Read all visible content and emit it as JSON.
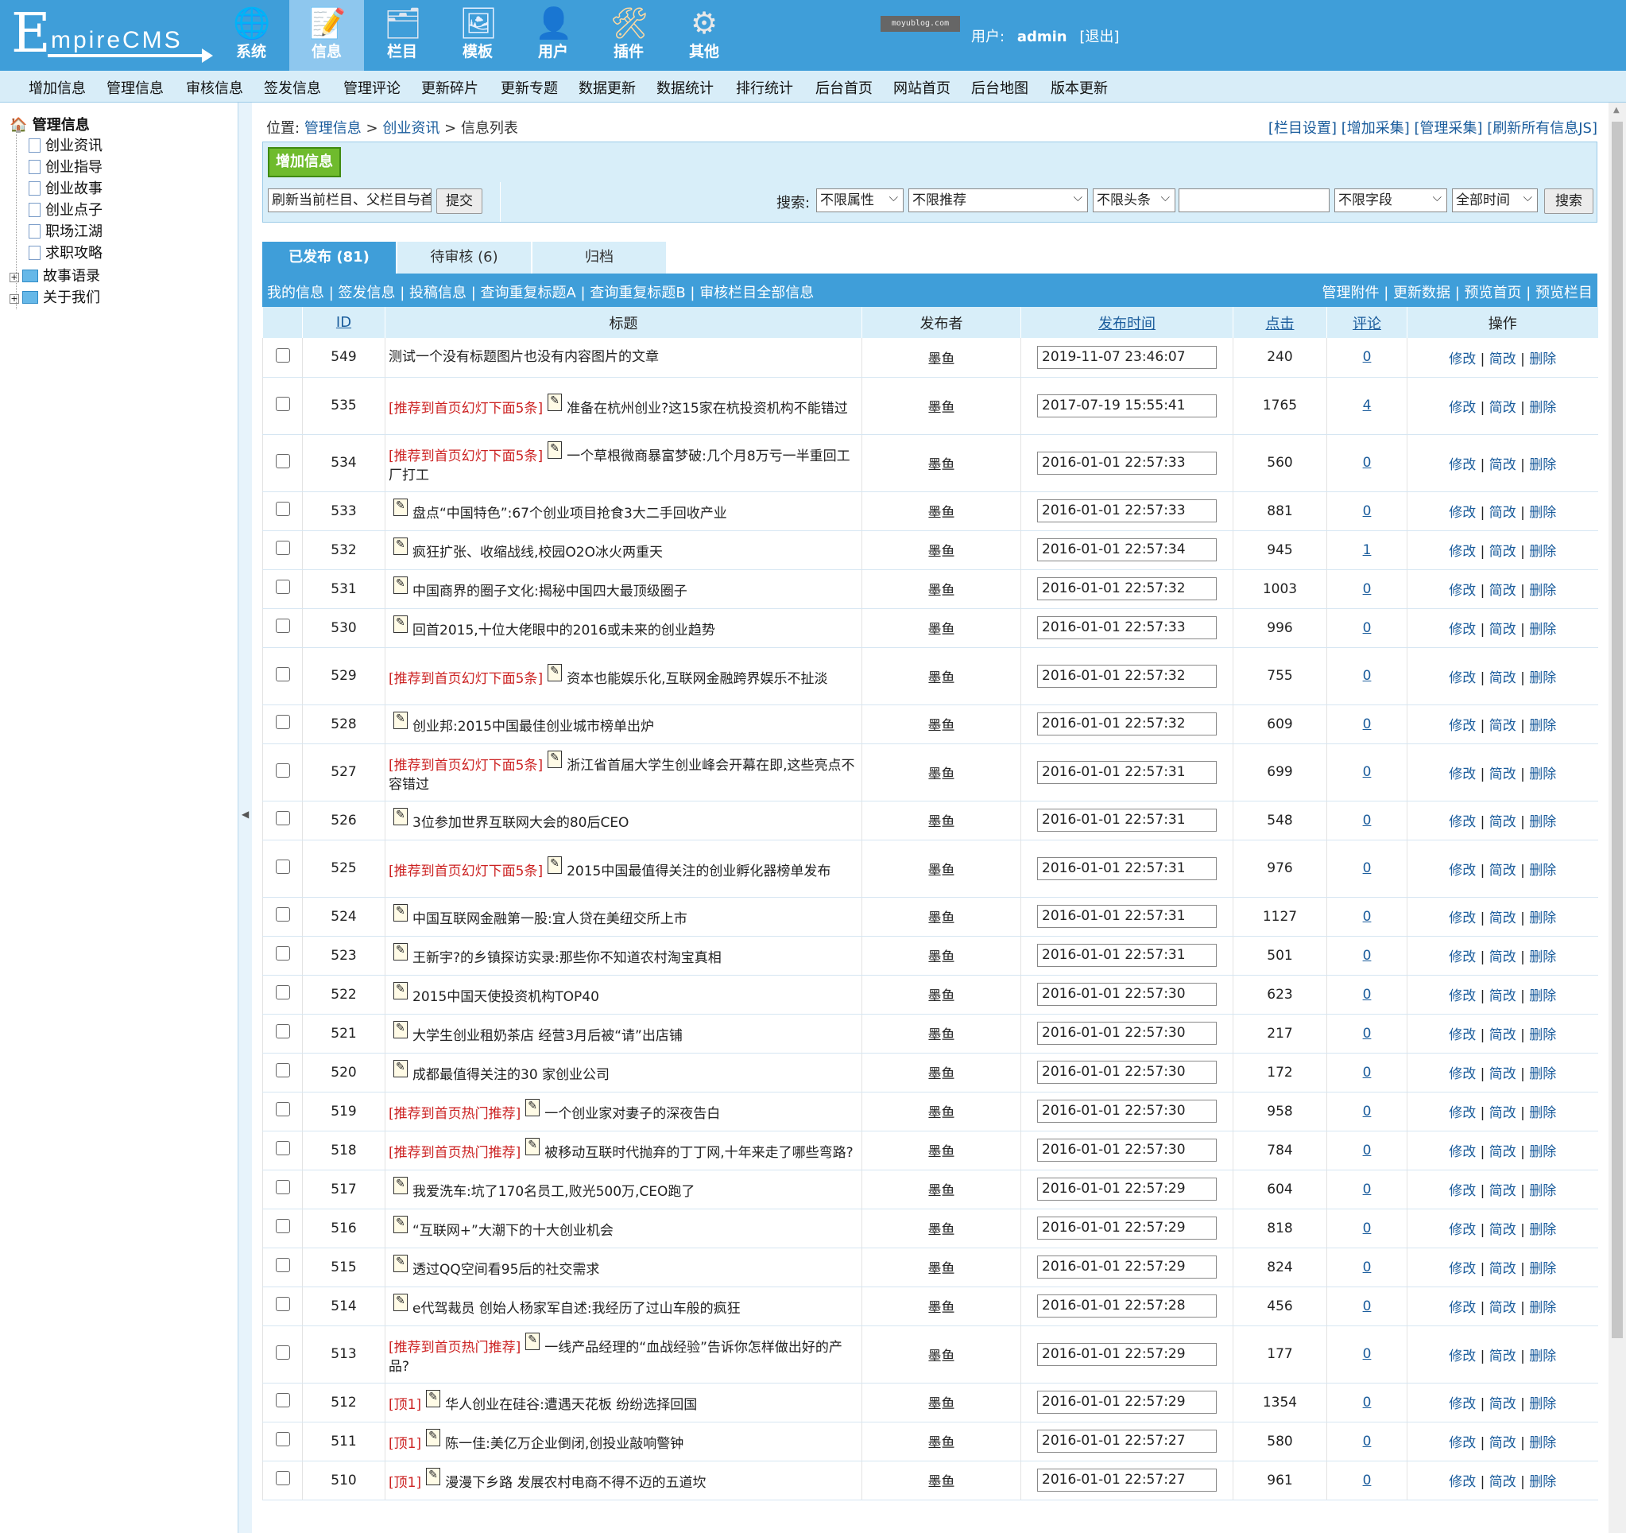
{
  "top": {
    "logo_initial": "E",
    "logo_rest": "mpireCMS",
    "stamp": "moyublog.com",
    "user_label": "用户:",
    "user_name": "admin",
    "logout": "[退出]",
    "menus": [
      {
        "label": "系统",
        "icon": "globe-icon",
        "glyph": "🌐"
      },
      {
        "label": "信息",
        "icon": "document-edit-icon",
        "glyph": "📝"
      },
      {
        "label": "栏目",
        "icon": "folder-icon",
        "glyph": "🗂"
      },
      {
        "label": "模板",
        "icon": "template-window-icon",
        "glyph": "🖼"
      },
      {
        "label": "用户",
        "icon": "user-icon",
        "glyph": "👤"
      },
      {
        "label": "插件",
        "icon": "plugin-tools-icon",
        "glyph": "🛠"
      },
      {
        "label": "其他",
        "icon": "gear-icon",
        "glyph": "⚙"
      }
    ]
  },
  "nav": [
    "增加信息",
    "管理信息",
    "审核信息",
    "签发信息",
    "管理评论",
    "更新碎片",
    "更新专题",
    "数据更新",
    "数据统计",
    "排行统计",
    "后台首页",
    "网站首页",
    "后台地图",
    "版本更新"
  ],
  "sidebar": {
    "root": "管理信息",
    "items": [
      "创业资讯",
      "创业指导",
      "创业故事",
      "创业点子",
      "职场江湖",
      "求职攻略"
    ],
    "folders": [
      "故事语录",
      "关于我们"
    ]
  },
  "crumb": {
    "label": "位置:",
    "a": "管理信息",
    "sep1": " > ",
    "b": "创业资讯",
    "sep2": " > ",
    "c": "信息列表",
    "right": "[栏目设置] [增加采集] [管理采集] [刷新所有信息JS]"
  },
  "panel": {
    "add": "增加信息",
    "refresh": "刷新当前栏目、父栏目与首页",
    "submit": "提交",
    "search_label": "搜索:",
    "attr": "不限属性",
    "recommend": "不限推荐",
    "headline": "不限头条",
    "field": "不限字段",
    "time": "全部时间",
    "search_btn": "搜索"
  },
  "tabs": [
    "已发布 (81)",
    "待审核 (6)",
    "归档"
  ],
  "bar": {
    "left": "我的信息 | 签发信息 | 投稿信息 | 查询重复标题A | 查询重复标题B | 审核栏目全部信息",
    "right": "管理附件 | 更新数据 | 预览首页 | 预览栏目"
  },
  "headers": [
    "ID",
    "标题",
    "发布者",
    "发布时间",
    "点击",
    "评论",
    "操作"
  ],
  "ops": [
    "修改",
    " | ",
    "简改",
    " | ",
    "删除"
  ],
  "rows": [
    {
      "id": "549",
      "tag": "",
      "title": "测试一个没有标题图片也没有内容图片的文章",
      "pub": "墨鱼",
      "time": "2019-11-07 23:46:07",
      "clicks": "240",
      "comments": "0",
      "icon": false
    },
    {
      "id": "535",
      "tag": "[推荐到首页幻灯下面5条]",
      "title": "准备在杭州创业?这15家在杭投资机构不能错过",
      "pub": "墨鱼",
      "time": "2017-07-19 15:55:41",
      "clicks": "1765",
      "comments": "4",
      "icon": true
    },
    {
      "id": "534",
      "tag": "[推荐到首页幻灯下面5条]",
      "title": "一个草根微商暴富梦破:几个月8万亏一半重回工厂打工",
      "pub": "墨鱼",
      "time": "2016-01-01 22:57:33",
      "clicks": "560",
      "comments": "0",
      "icon": true
    },
    {
      "id": "533",
      "tag": "",
      "title": "盘点“中国特色”:67个创业项目抢食3大二手回收产业",
      "pub": "墨鱼",
      "time": "2016-01-01 22:57:33",
      "clicks": "881",
      "comments": "0",
      "icon": true
    },
    {
      "id": "532",
      "tag": "",
      "title": "疯狂扩张、收缩战线,校园O2O冰火两重天",
      "pub": "墨鱼",
      "time": "2016-01-01 22:57:34",
      "clicks": "945",
      "comments": "1",
      "icon": true
    },
    {
      "id": "531",
      "tag": "",
      "title": "中国商界的圈子文化:揭秘中国四大最顶级圈子",
      "pub": "墨鱼",
      "time": "2016-01-01 22:57:32",
      "clicks": "1003",
      "comments": "0",
      "icon": true
    },
    {
      "id": "530",
      "tag": "",
      "title": "回首2015,十位大佬眼中的2016或未来的创业趋势",
      "pub": "墨鱼",
      "time": "2016-01-01 22:57:33",
      "clicks": "996",
      "comments": "0",
      "icon": true
    },
    {
      "id": "529",
      "tag": "[推荐到首页幻灯下面5条]",
      "title": "资本也能娱乐化,互联网金融跨界娱乐不扯淡",
      "pub": "墨鱼",
      "time": "2016-01-01 22:57:32",
      "clicks": "755",
      "comments": "0",
      "icon": true
    },
    {
      "id": "528",
      "tag": "",
      "title": "创业邦:2015中国最佳创业城市榜单出炉",
      "pub": "墨鱼",
      "time": "2016-01-01 22:57:32",
      "clicks": "609",
      "comments": "0",
      "icon": true
    },
    {
      "id": "527",
      "tag": "[推荐到首页幻灯下面5条]",
      "title": "浙江省首届大学生创业峰会开幕在即,这些亮点不容错过",
      "pub": "墨鱼",
      "time": "2016-01-01 22:57:31",
      "clicks": "699",
      "comments": "0",
      "icon": true
    },
    {
      "id": "526",
      "tag": "",
      "title": "3位参加世界互联网大会的80后CEO",
      "pub": "墨鱼",
      "time": "2016-01-01 22:57:31",
      "clicks": "548",
      "comments": "0",
      "icon": true
    },
    {
      "id": "525",
      "tag": "[推荐到首页幻灯下面5条]",
      "title": "2015中国最值得关注的创业孵化器榜单发布",
      "pub": "墨鱼",
      "time": "2016-01-01 22:57:31",
      "clicks": "976",
      "comments": "0",
      "icon": true
    },
    {
      "id": "524",
      "tag": "",
      "title": "中国互联网金融第一股:宜人贷在美纽交所上市",
      "pub": "墨鱼",
      "time": "2016-01-01 22:57:31",
      "clicks": "1127",
      "comments": "0",
      "icon": true
    },
    {
      "id": "523",
      "tag": "",
      "title": "王新宇?的乡镇探访实录:那些你不知道农村淘宝真相",
      "pub": "墨鱼",
      "time": "2016-01-01 22:57:31",
      "clicks": "501",
      "comments": "0",
      "icon": true
    },
    {
      "id": "522",
      "tag": "",
      "title": "2015中国天使投资机构TOP40",
      "pub": "墨鱼",
      "time": "2016-01-01 22:57:30",
      "clicks": "623",
      "comments": "0",
      "icon": true
    },
    {
      "id": "521",
      "tag": "",
      "title": "大学生创业租奶茶店 经营3月后被“请”出店铺",
      "pub": "墨鱼",
      "time": "2016-01-01 22:57:30",
      "clicks": "217",
      "comments": "0",
      "icon": true
    },
    {
      "id": "520",
      "tag": "",
      "title": "成都最值得关注的30 家创业公司",
      "pub": "墨鱼",
      "time": "2016-01-01 22:57:30",
      "clicks": "172",
      "comments": "0",
      "icon": true
    },
    {
      "id": "519",
      "tag": "[推荐到首页热门推荐]",
      "title": "一个创业家对妻子的深夜告白",
      "pub": "墨鱼",
      "time": "2016-01-01 22:57:30",
      "clicks": "958",
      "comments": "0",
      "icon": true
    },
    {
      "id": "518",
      "tag": "[推荐到首页热门推荐]",
      "title": "被移动互联时代抛弃的丁丁网,十年来走了哪些弯路?",
      "pub": "墨鱼",
      "time": "2016-01-01 22:57:30",
      "clicks": "784",
      "comments": "0",
      "icon": true
    },
    {
      "id": "517",
      "tag": "",
      "title": "我爱洗车:坑了170名员工,败光500万,CEO跑了",
      "pub": "墨鱼",
      "time": "2016-01-01 22:57:29",
      "clicks": "604",
      "comments": "0",
      "icon": true
    },
    {
      "id": "516",
      "tag": "",
      "title": "“互联网+”大潮下的十大创业机会",
      "pub": "墨鱼",
      "time": "2016-01-01 22:57:29",
      "clicks": "818",
      "comments": "0",
      "icon": true
    },
    {
      "id": "515",
      "tag": "",
      "title": "透过QQ空间看95后的社交需求",
      "pub": "墨鱼",
      "time": "2016-01-01 22:57:29",
      "clicks": "824",
      "comments": "0",
      "icon": true
    },
    {
      "id": "514",
      "tag": "",
      "title": "e代驾裁员 创始人杨家军自述:我经历了过山车般的疯狂",
      "pub": "墨鱼",
      "time": "2016-01-01 22:57:28",
      "clicks": "456",
      "comments": "0",
      "icon": true
    },
    {
      "id": "513",
      "tag": "[推荐到首页热门推荐]",
      "title": "一线产品经理的“血战经验”告诉你怎样做出好的产品?",
      "pub": "墨鱼",
      "time": "2016-01-01 22:57:29",
      "clicks": "177",
      "comments": "0",
      "icon": true
    },
    {
      "id": "512",
      "tag": "[顶1]",
      "title": "华人创业在硅谷:遭遇天花板 纷纷选择回国",
      "pub": "墨鱼",
      "time": "2016-01-01 22:57:29",
      "clicks": "1354",
      "comments": "0",
      "icon": true
    },
    {
      "id": "511",
      "tag": "[顶1]",
      "title": "陈一佳:美亿万企业倒闭,创投业敲响警钟",
      "pub": "墨鱼",
      "time": "2016-01-01 22:57:27",
      "clicks": "580",
      "comments": "0",
      "icon": true
    },
    {
      "id": "510",
      "tag": "[顶1]",
      "title": "漫漫下乡路 发展农村电商不得不迈的五道坎",
      "pub": "墨鱼",
      "time": "2016-01-01 22:57:27",
      "clicks": "961",
      "comments": "0",
      "icon": true
    }
  ]
}
